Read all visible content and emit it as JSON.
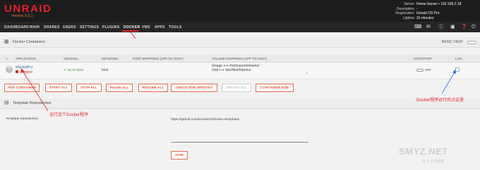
{
  "header": {
    "logo": "UNRAID",
    "version": "Version: 6.9.1",
    "server_info_labels": [
      "Server",
      "Description",
      "Registration",
      "Uptime"
    ],
    "server_info_values": [
      "Home-Server • 192.168.2.18",
      "-",
      "Unraid OS Pro",
      "31 minutes"
    ]
  },
  "nav": {
    "items": [
      "DASHBOARD",
      "MAIN",
      "SHARES",
      "USERS",
      "SETTINGS",
      "PLUGINS",
      "DOCKER",
      "VMS",
      "APPS",
      "TOOLS"
    ],
    "active": "DOCKER",
    "icons": [
      "terminal-icon",
      "feedback-icon",
      "info-icon",
      "monitor-icon",
      "help-icon",
      "logout-icon"
    ]
  },
  "docker_section": {
    "title": "Docker Containers",
    "basic_view_label": "BASIC VIEW",
    "columns": [
      "APPLICATION",
      "VERSION",
      "NETWORK",
      "PORT MAPPINGS (APP TO HOST)",
      "VOLUME MAPPINGS (APP TO HOST)",
      "AUTOSTART",
      "LOG"
    ],
    "rows": [
      {
        "name": "MacinaBox",
        "status": "stopped",
        "version": "up-to-date",
        "network": "host",
        "volume_1": "/image ⟷ /mnt/user/domains/",
        "volume_2": "/xml ⟷ /etc/libvirt/qemu/",
        "autostart": "OFF"
      }
    ],
    "buttons": [
      "ADD CONTAINER",
      "START ALL",
      "STOP ALL",
      "PAUSE ALL",
      "RESUME ALL",
      "CHECK FOR UPDATES",
      "UPDATE ALL",
      "CONTAINER SIZE"
    ]
  },
  "template_section": {
    "title": "Template Repositories",
    "label": "Template repositories:",
    "value": "https://github.com/ironetech/docker-templates",
    "save_label": "SAVE"
  },
  "annotations": {
    "left": "运行这个Docker程序",
    "right": "Docker程序运行后点这里"
  },
  "watermark": {
    "main": "SMYZ.NET",
    "sub": "值 什么值得买"
  },
  "colors": {
    "brand": "#e4232a",
    "accent_orange": "#e36b4a",
    "header_bg": "#1c1c1c",
    "status_stopped": "#d3262b",
    "status_ok": "#4caf50"
  }
}
